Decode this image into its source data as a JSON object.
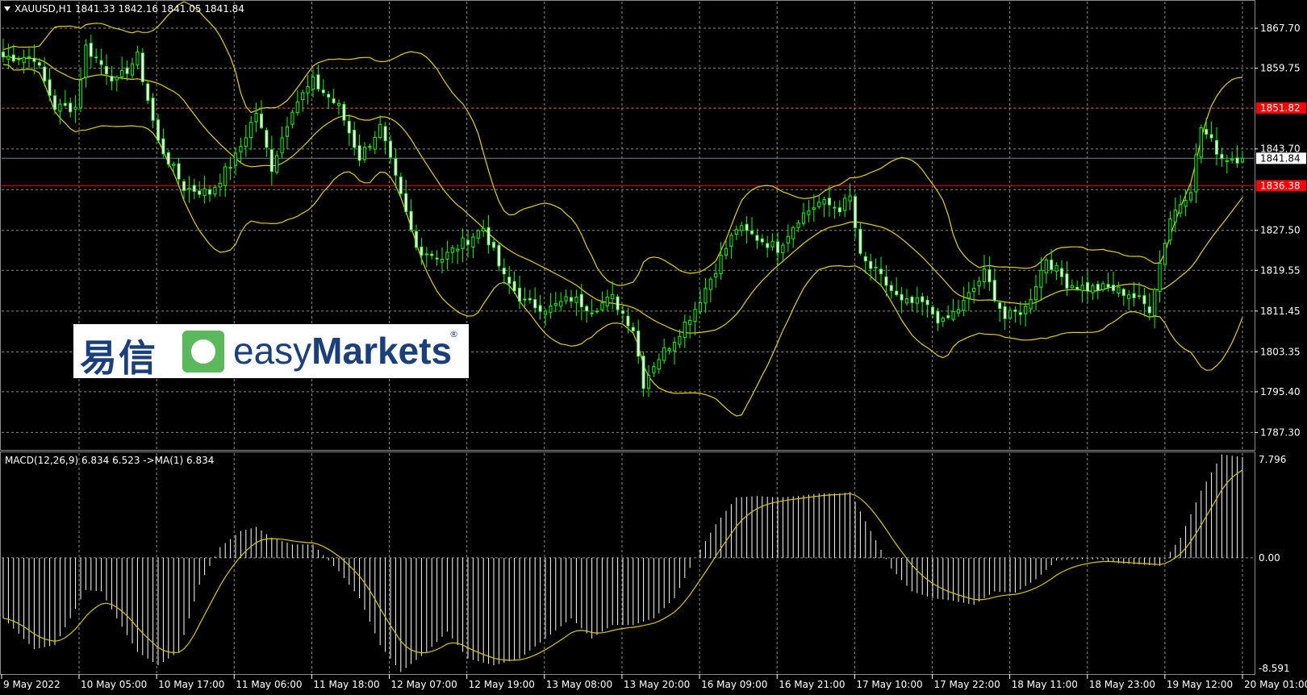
{
  "header": {
    "symbol": "XAUUSD,H1",
    "ohlc": "1841.33 1842.16 1841.05 1841.84",
    "dropdown_icon": "triangle-down-icon"
  },
  "macd_header": "MACD(12,26,9) 6.834 6.523  ->MA(1) 6.834",
  "price_axis": [
    "1867.70",
    "1859.75",
    "1851.82",
    "1843.70",
    "1841.84",
    "1836.38",
    "1827.50",
    "1819.55",
    "1811.45",
    "1803.35",
    "1795.40",
    "1787.30"
  ],
  "macd_axis": [
    "7.796",
    "0.00",
    "-8.591"
  ],
  "time_axis": [
    "9 May 2022",
    "10 May 05:00",
    "10 May 17:00",
    "11 May 06:00",
    "11 May 18:00",
    "12 May 07:00",
    "12 May 19:00",
    "13 May 08:00",
    "13 May 20:00",
    "16 May 09:00",
    "16 May 21:00",
    "17 May 10:00",
    "17 May 22:00",
    "18 May 11:00",
    "18 May 23:00",
    "19 May 12:00",
    "20 May 01:00"
  ],
  "levels": {
    "upper": {
      "label": "1851.82",
      "value": 1851.82,
      "color": "#ff0000"
    },
    "current": {
      "label": "1841.84",
      "value": 1841.84,
      "color": "#708090"
    },
    "lower": {
      "label": "1836.38",
      "value": 1836.38,
      "color": "#ff0000"
    }
  },
  "logo": {
    "chinese": "易信",
    "text_light": "easy",
    "text_bold": "Markets",
    "reg": "®",
    "icon": "easymarkets-logo-icon"
  },
  "colors": {
    "background": "#000000",
    "grid": "#8a8a8a",
    "candle": "#00ff00",
    "bands": "#e6d200",
    "signal": "#d8c800",
    "hist": "#ffffff"
  },
  "chart_data": {
    "type": "candlestick",
    "symbol": "XAUUSD",
    "timeframe": "H1",
    "ylim": [
      1784,
      1873
    ],
    "close_path_anchors": [
      [
        0,
        1862
      ],
      [
        6,
        1862
      ],
      [
        10,
        1852
      ],
      [
        14,
        1852
      ],
      [
        16,
        1864
      ],
      [
        22,
        1857
      ],
      [
        26,
        1862
      ],
      [
        30,
        1845
      ],
      [
        35,
        1836
      ],
      [
        40,
        1835
      ],
      [
        45,
        1842
      ],
      [
        49,
        1851
      ],
      [
        52,
        1840
      ],
      [
        56,
        1852
      ],
      [
        60,
        1857
      ],
      [
        65,
        1852
      ],
      [
        69,
        1842
      ],
      [
        73,
        1848
      ],
      [
        77,
        1834
      ],
      [
        80,
        1824
      ],
      [
        85,
        1822
      ],
      [
        89,
        1825
      ],
      [
        93,
        1828
      ],
      [
        97,
        1818
      ],
      [
        101,
        1813
      ],
      [
        106,
        1812
      ],
      [
        110,
        1814
      ],
      [
        114,
        1812
      ],
      [
        118,
        1814
      ],
      [
        122,
        1808
      ],
      [
        124,
        1797
      ],
      [
        126,
        1801
      ],
      [
        130,
        1806
      ],
      [
        134,
        1812
      ],
      [
        138,
        1820
      ],
      [
        142,
        1828
      ],
      [
        146,
        1826
      ],
      [
        150,
        1824
      ],
      [
        154,
        1830
      ],
      [
        158,
        1833
      ],
      [
        162,
        1832
      ],
      [
        164,
        1834
      ],
      [
        166,
        1822
      ],
      [
        170,
        1818
      ],
      [
        174,
        1813
      ],
      [
        178,
        1813
      ],
      [
        182,
        1809
      ],
      [
        186,
        1813
      ],
      [
        190,
        1819
      ],
      [
        194,
        1810
      ],
      [
        198,
        1812
      ],
      [
        202,
        1822
      ],
      [
        206,
        1817
      ],
      [
        210,
        1816
      ],
      [
        214,
        1816
      ],
      [
        218,
        1815
      ],
      [
        222,
        1812
      ],
      [
        226,
        1830
      ],
      [
        230,
        1836
      ],
      [
        232,
        1848
      ],
      [
        236,
        1842
      ],
      [
        240,
        1841.84
      ]
    ],
    "macd_anchors": [
      [
        0,
        -4.5
      ],
      [
        6,
        -6.8
      ],
      [
        10,
        -6.5
      ],
      [
        13,
        -4.5
      ],
      [
        16,
        -2.4
      ],
      [
        19,
        -2.5
      ],
      [
        22,
        -4.5
      ],
      [
        26,
        -7
      ],
      [
        30,
        -8
      ],
      [
        34,
        -7
      ],
      [
        38,
        -2
      ],
      [
        42,
        0.8
      ],
      [
        46,
        2
      ],
      [
        49,
        2.3
      ],
      [
        52,
        1.5
      ],
      [
        56,
        1
      ],
      [
        60,
        1
      ],
      [
        65,
        -1
      ],
      [
        69,
        -3
      ],
      [
        73,
        -6.5
      ],
      [
        77,
        -8.5
      ],
      [
        82,
        -7
      ],
      [
        86,
        -5.5
      ],
      [
        90,
        -7.5
      ],
      [
        95,
        -8
      ],
      [
        100,
        -7.5
      ],
      [
        105,
        -6
      ],
      [
        110,
        -4.5
      ],
      [
        114,
        -6
      ],
      [
        118,
        -5
      ],
      [
        122,
        -5
      ],
      [
        126,
        -4.5
      ],
      [
        130,
        -3
      ],
      [
        134,
        0
      ],
      [
        138,
        2.5
      ],
      [
        142,
        4.5
      ],
      [
        146,
        4.6
      ],
      [
        150,
        4.5
      ],
      [
        154,
        4.6
      ],
      [
        158,
        4.8
      ],
      [
        162,
        4.8
      ],
      [
        164,
        4.9
      ],
      [
        168,
        2
      ],
      [
        172,
        -0.8
      ],
      [
        176,
        -2.5
      ],
      [
        180,
        -3
      ],
      [
        184,
        -3.2
      ],
      [
        188,
        -3.5
      ],
      [
        192,
        -2.5
      ],
      [
        196,
        -2.6
      ],
      [
        200,
        -1.6
      ],
      [
        204,
        -0.2
      ],
      [
        208,
        -0.1
      ],
      [
        212,
        -0.1
      ],
      [
        216,
        -0.4
      ],
      [
        220,
        -0.5
      ],
      [
        224,
        -0.6
      ],
      [
        228,
        1.5
      ],
      [
        232,
        5
      ],
      [
        236,
        7.7
      ],
      [
        240,
        7.5
      ]
    ],
    "series": [
      {
        "name": "Bollinger upper (approx)",
        "values": [
          1873,
          1868,
          1862,
          1870,
          1865,
          1857,
          1858,
          1870,
          1866,
          1835,
          1833,
          1825,
          1835,
          1832,
          1832,
          1832,
          1855
        ]
      },
      {
        "name": "Bollinger lower (approx)",
        "values": [
          1852,
          1838,
          1827,
          1836,
          1832,
          1845,
          1812,
          1812,
          1803,
          1795,
          1795,
          1805,
          1804,
          1805,
          1810,
          1801,
          1806
        ]
      }
    ],
    "x_tick_labels": [
      "9 May 2022",
      "10 May 05:00",
      "10 May 17:00",
      "11 May 06:00",
      "11 May 18:00",
      "12 May 07:00",
      "12 May 19:00",
      "13 May 08:00",
      "13 May 20:00",
      "16 May 09:00",
      "16 May 21:00",
      "17 May 10:00",
      "17 May 22:00",
      "18 May 11:00",
      "18 May 23:00",
      "19 May 12:00",
      "20 May 01:00"
    ],
    "y_tick_labels": [
      "1867.70",
      "1859.75",
      "1851.82",
      "1843.70",
      "1827.50",
      "1819.55",
      "1811.45",
      "1803.35",
      "1795.40",
      "1787.30"
    ],
    "subchart": {
      "type": "histogram+line",
      "title": "MACD(12,26,9) 6.834 6.523  ->MA(1) 6.834",
      "ylim": [
        -8.591,
        7.796
      ]
    },
    "grid": true
  }
}
